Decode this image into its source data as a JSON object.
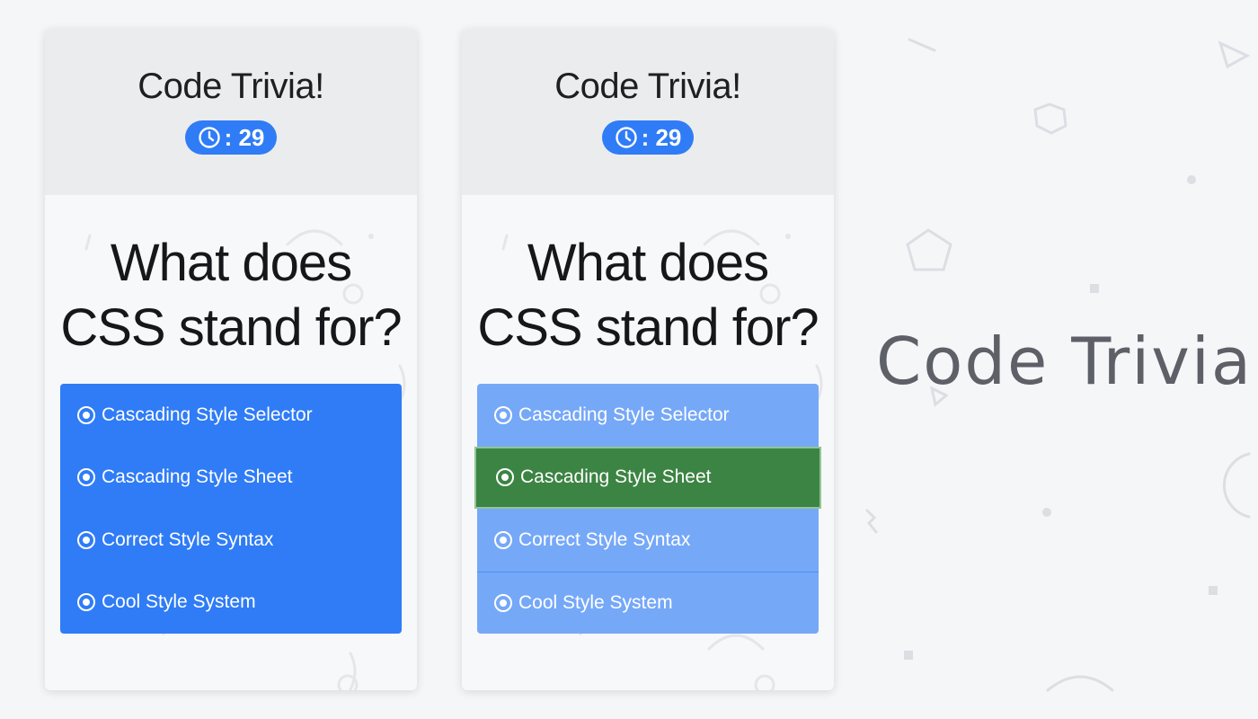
{
  "colors": {
    "accent": "#2f7cf6",
    "answer_dimmed": "#76a8f8",
    "correct": "#3c8443",
    "header_bg": "#ebecee"
  },
  "brand_title": "Code Trivia",
  "screens": [
    {
      "state": "unanswered",
      "app_title": "Code Trivia!",
      "timer": {
        "icon": "clock-icon",
        "value": ": 29"
      },
      "question": "What does\nCSS stand for?",
      "answers": [
        {
          "icon": "radio-icon",
          "label": "Cascading Style Selector"
        },
        {
          "icon": "radio-icon",
          "label": "Cascading Style Sheet"
        },
        {
          "icon": "radio-icon",
          "label": "Correct Style Syntax"
        },
        {
          "icon": "radio-icon",
          "label": "Cool Style System"
        }
      ]
    },
    {
      "state": "answered",
      "app_title": "Code Trivia!",
      "timer": {
        "icon": "clock-icon",
        "value": ": 29"
      },
      "question": "What does\nCSS stand for?",
      "answers": [
        {
          "icon": "radio-icon",
          "label": "Cascading Style Selector"
        },
        {
          "icon": "radio-icon",
          "label": "Cascading Style Sheet",
          "highlight": "correct"
        },
        {
          "icon": "radio-icon",
          "label": "Correct Style Syntax"
        },
        {
          "icon": "radio-icon",
          "label": "Cool Style System"
        }
      ]
    }
  ]
}
